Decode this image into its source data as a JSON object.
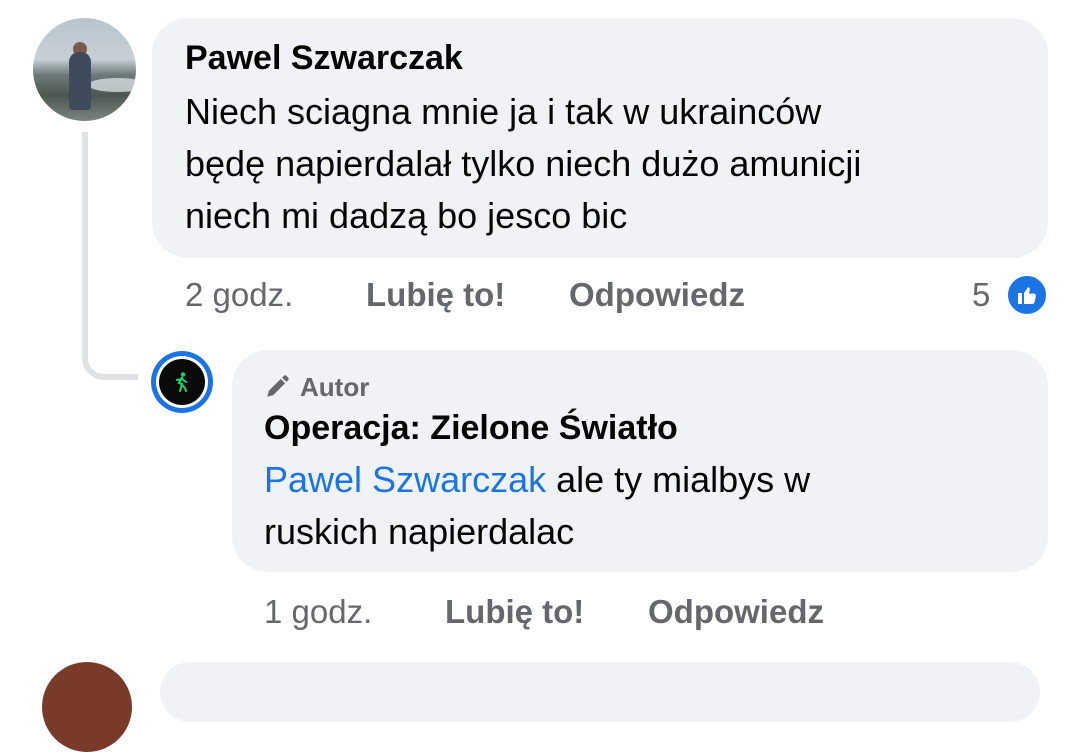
{
  "comment": {
    "author": "Pawel Szwarczak",
    "text_lines": [
      "Niech sciagna mnie ja i tak w ukrainców",
      "będę napierdalał tylko niech dużo amunicji",
      "niech mi dadzą bo jesco bic"
    ],
    "time": "2 godz.",
    "like_label": "Lubię to!",
    "reply_label": "Odpowiedz",
    "reaction_count": "5"
  },
  "reply": {
    "badge_label": "Autor",
    "author": "Operacja: Zielone Światło",
    "mention": "Pawel Szwarczak",
    "text_after_mention": " ale ty mialbys w",
    "text_line2": "ruskich napierdalac",
    "time": "1 godz.",
    "like_label": "Lubię to!",
    "reply_label": "Odpowiedz"
  },
  "colors": {
    "bubble": "#f0f2f5",
    "mention": "#1b74e4",
    "meta": "#65676b",
    "like_badge": "#1b74e4"
  }
}
